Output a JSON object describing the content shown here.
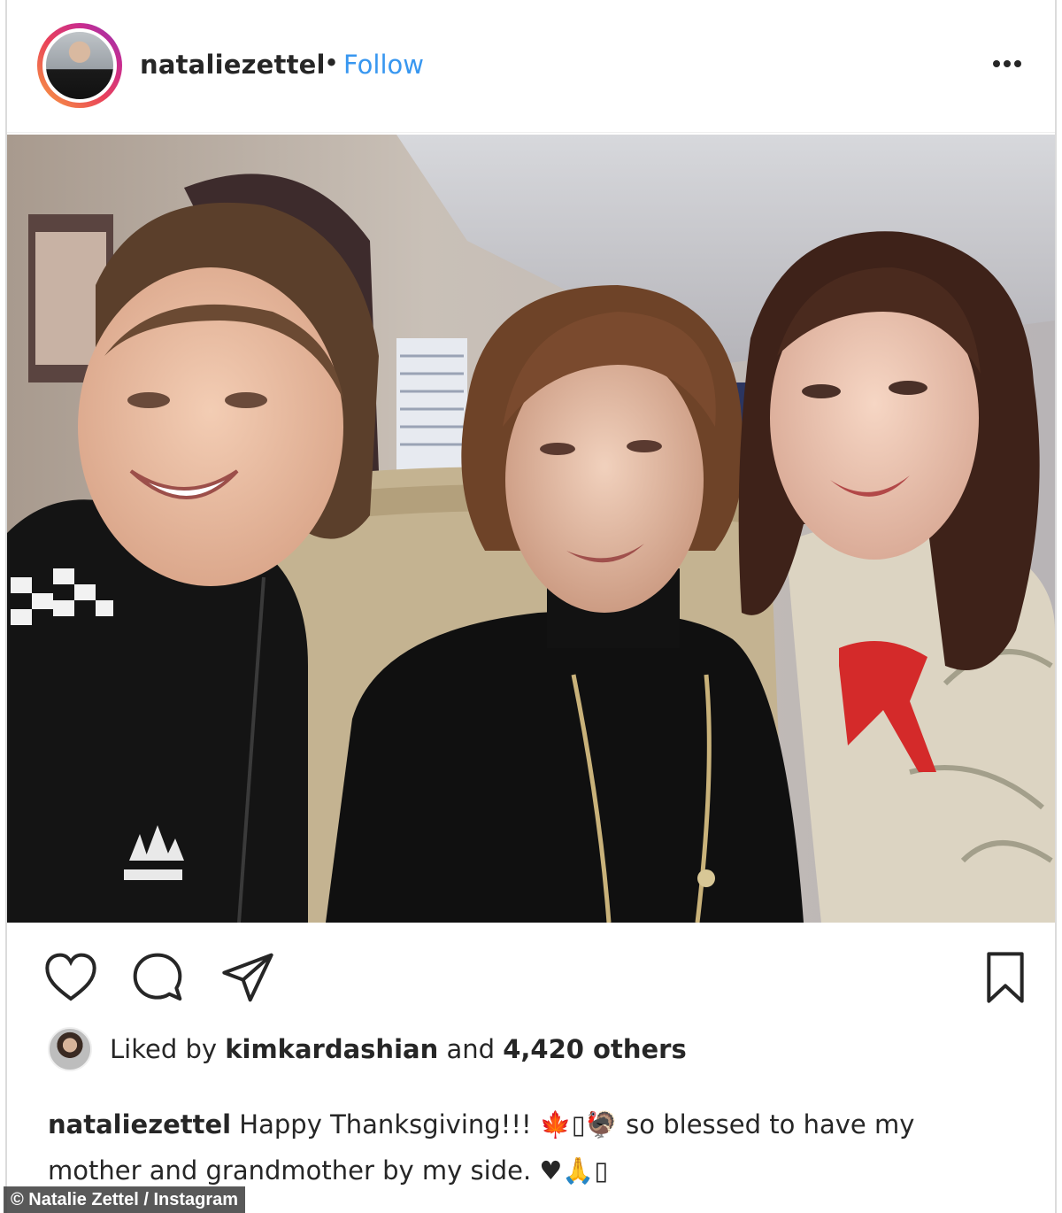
{
  "post": {
    "username": "nataliezettel",
    "separator": "•",
    "follow_label": "Follow",
    "more_icon": "more-options-icon"
  },
  "photo": {
    "subject": "photo-of-three-people"
  },
  "actions": {
    "like_icon": "heart-icon",
    "comment_icon": "comment-icon",
    "share_icon": "paper-plane-icon",
    "save_icon": "bookmark-icon"
  },
  "likes": {
    "prefix": "Liked by ",
    "user": "kimkardashian",
    "middle": " and ",
    "count": "4,420 others"
  },
  "caption": {
    "username": "nataliezettel",
    "line1": " Happy Thanksgiving!!! 🍁▯🦃 so blessed to have my",
    "line2": "mother and grandmother by my side. ♥🙏▯"
  },
  "credit": {
    "text": "© Natalie Zettel / Instagram"
  },
  "colors": {
    "link": "#3897f0",
    "text": "#262626",
    "border": "#dbdbdb"
  }
}
